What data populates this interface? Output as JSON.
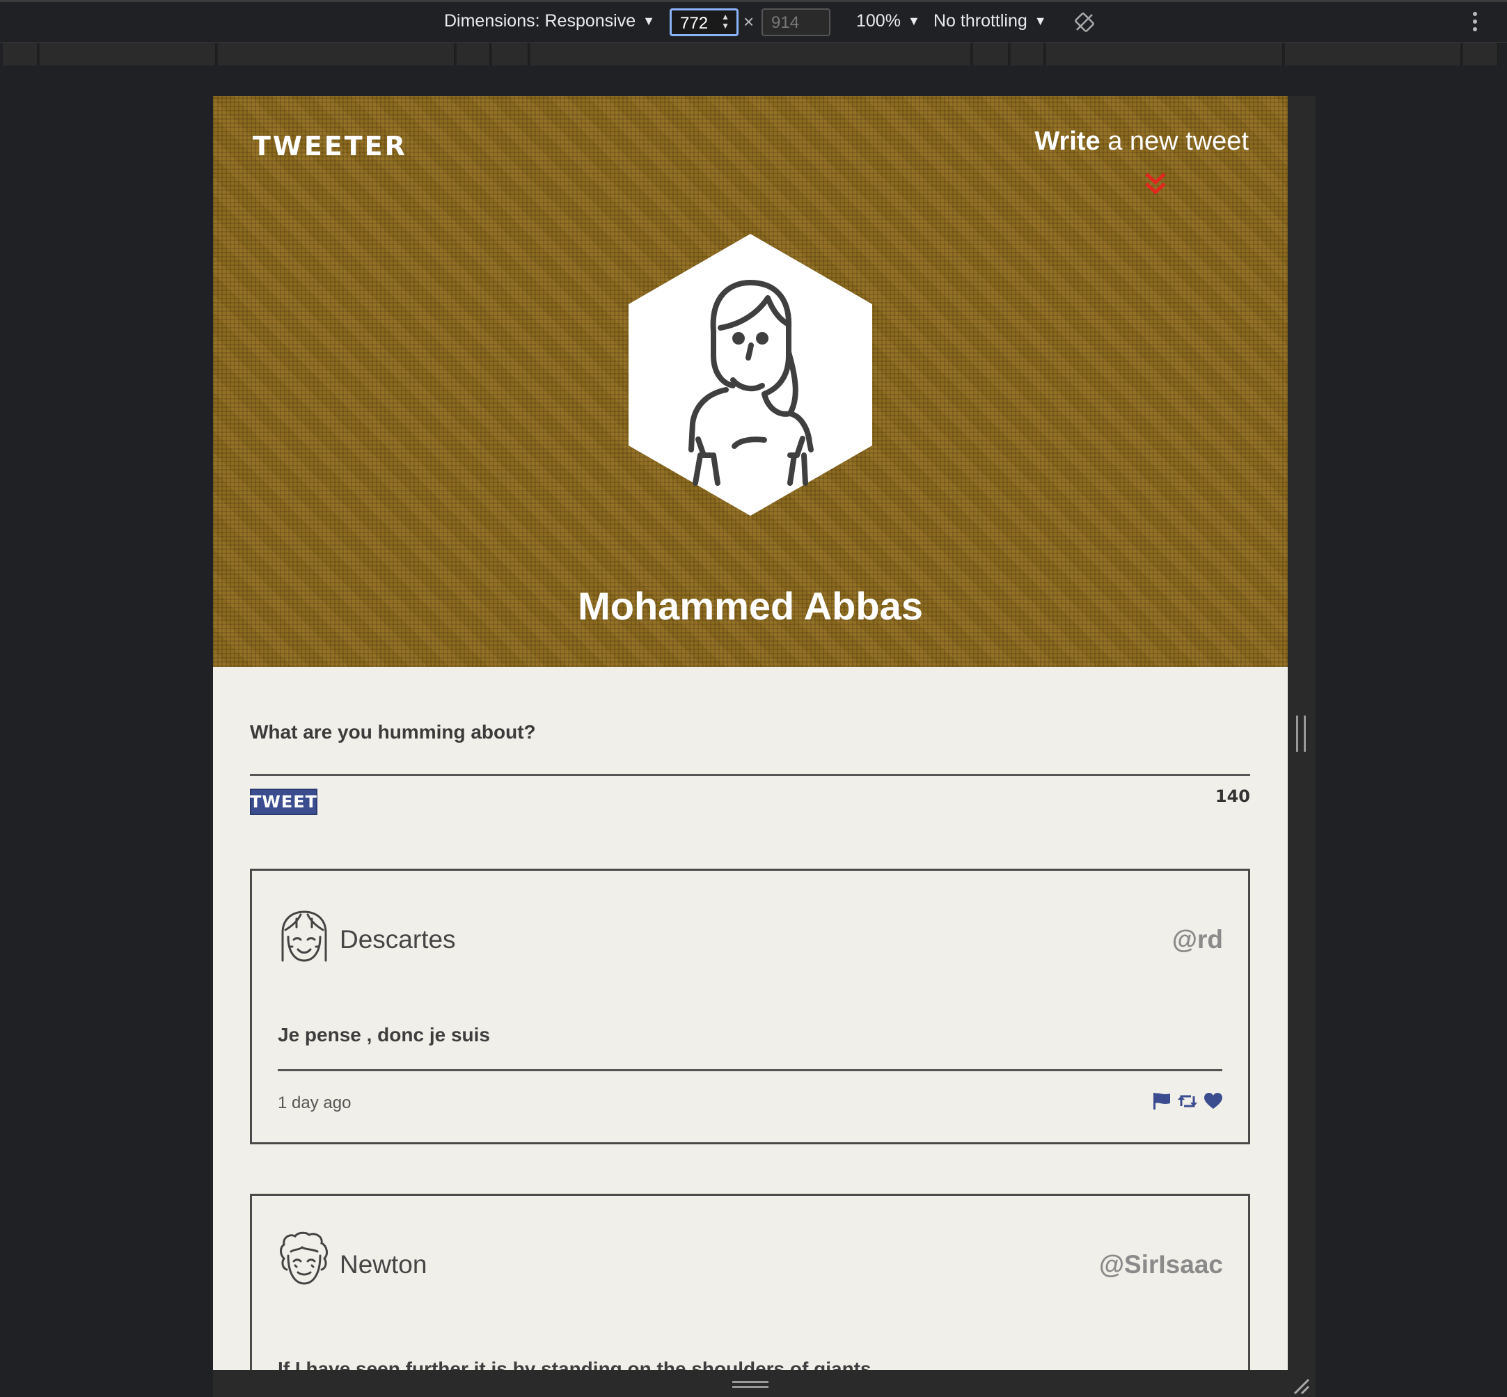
{
  "devtools": {
    "dimensions_label": "Dimensions: Responsive",
    "width_value": "772",
    "height_placeholder": "914",
    "times": "×",
    "zoom": "100%",
    "throttling": "No throttling"
  },
  "app": {
    "brand": "TWEETER",
    "write_bold": "Write",
    "write_rest": " a new tweet",
    "profile_name": "Mohammed Abbas"
  },
  "composer": {
    "prompt": "What are you humming about?",
    "button_label": "TWEET",
    "counter": "140"
  },
  "tweets": [
    {
      "author": "Descartes",
      "handle": "@rd",
      "content": "Je pense , donc je suis",
      "time": "1 day ago"
    },
    {
      "author": "Newton",
      "handle": "@SirIsaac",
      "content": "If I have seen further it is by standing on the shoulders of giants"
    }
  ],
  "colors": {
    "hero": "#8c6a1f",
    "accent": "#3b4d8f",
    "chevron": "#e0281e",
    "page_bg": "#f1efea"
  },
  "icons": [
    "rotate-icon",
    "more-icon",
    "chevron-double-down-icon",
    "flag-icon",
    "retweet-icon",
    "heart-icon"
  ]
}
